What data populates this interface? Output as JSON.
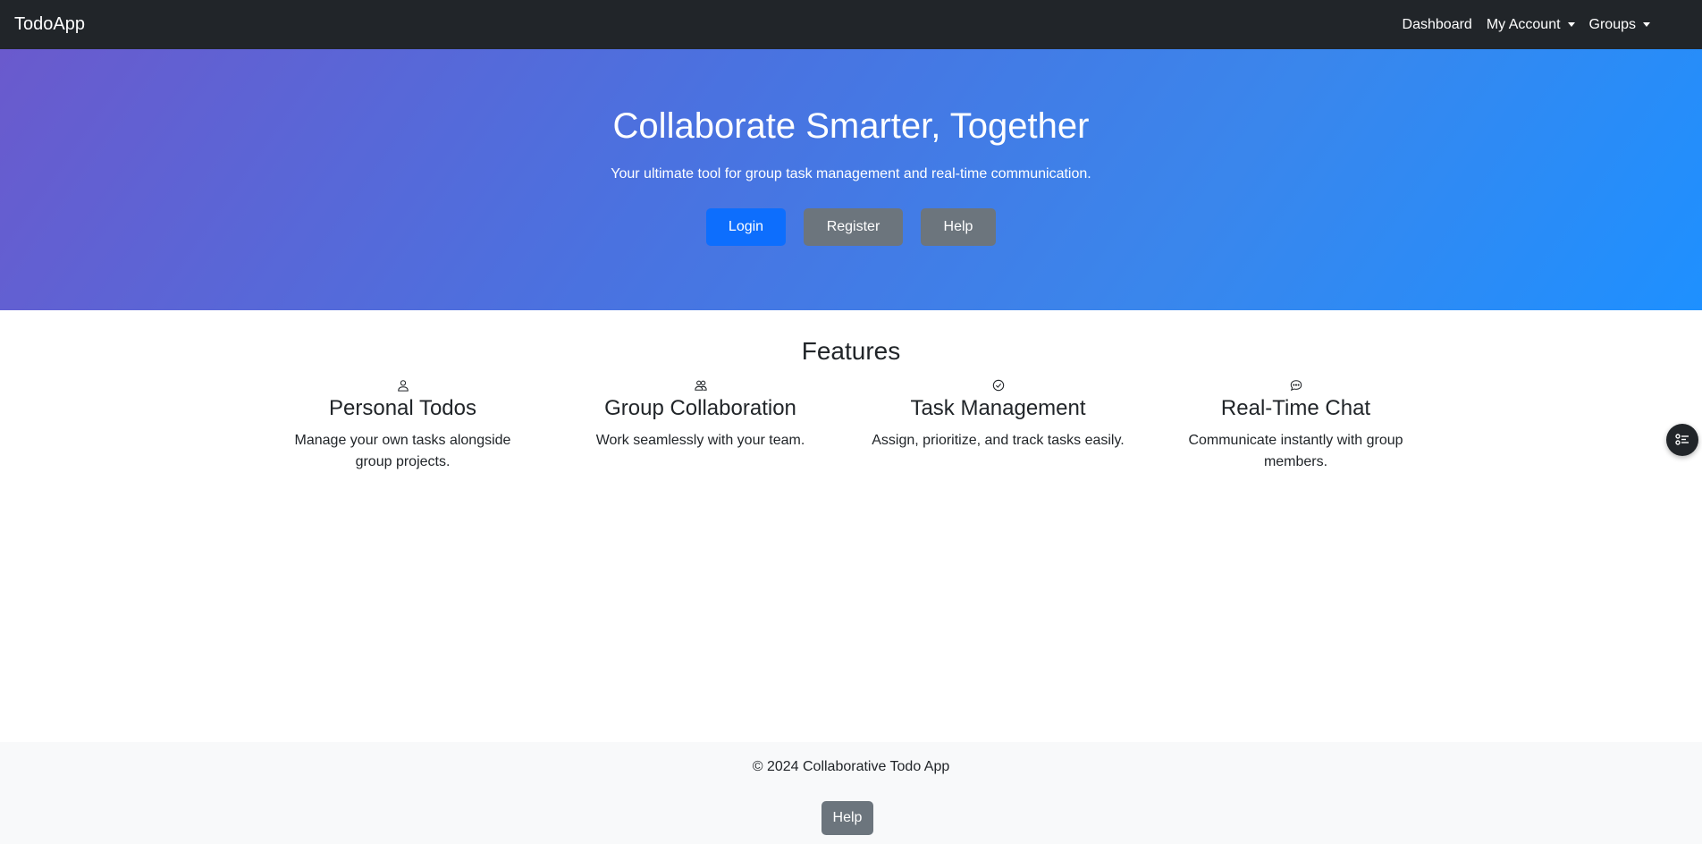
{
  "navbar": {
    "brand": "TodoApp",
    "links": {
      "dashboard": "Dashboard",
      "my_account": "My Account",
      "groups": "Groups"
    }
  },
  "hero": {
    "title": "Collaborate Smarter, Together",
    "subtitle": "Your ultimate tool for group task management and real-time communication.",
    "buttons": {
      "login": "Login",
      "register": "Register",
      "help": "Help"
    }
  },
  "features": {
    "heading": "Features",
    "items": [
      {
        "icon": "person-icon",
        "title": "Personal Todos",
        "description": "Manage your own tasks alongside group projects."
      },
      {
        "icon": "people-icon",
        "title": "Group Collaboration",
        "description": "Work seamlessly with your team."
      },
      {
        "icon": "check-circle-icon",
        "title": "Task Management",
        "description": "Assign, prioritize, and track tasks easily."
      },
      {
        "icon": "chat-icon",
        "title": "Real-Time Chat",
        "description": "Communicate instantly with group members."
      }
    ]
  },
  "floating_button": {
    "icon": "task-list-icon"
  },
  "footer": {
    "copyright": "© 2024 Collaborative Todo App",
    "help_label": "Help"
  },
  "colors": {
    "navbar_bg": "#212529",
    "primary": "#0d6efd",
    "secondary": "#6c757d",
    "hero_gradient_start": "#6a5acd",
    "hero_gradient_end": "#1e90ff",
    "footer_bg": "#f8f9fa"
  }
}
